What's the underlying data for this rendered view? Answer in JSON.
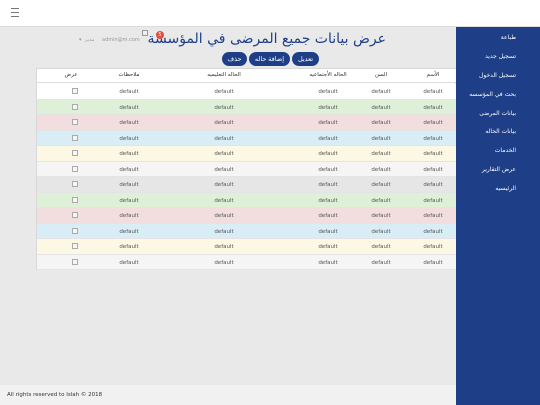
{
  "topbar": {
    "menu_icon": "hamburger-icon"
  },
  "header": {
    "title": "عرض بيانات جميع المرضى في المؤسسة",
    "notification_count": "5",
    "user_email": "admin@m.com",
    "user_role": "مدير"
  },
  "actions": {
    "edit_label": "تعديل",
    "add_label": "إضافة حاله",
    "delete_label": "حذف"
  },
  "sidebar": {
    "items": [
      {
        "label": "طباعة"
      },
      {
        "label": "تسجيل جديد"
      },
      {
        "label": "تسجيل الدخول"
      },
      {
        "label": "بحث في المؤسسه"
      },
      {
        "label": "بيانات المرضى"
      },
      {
        "label": "بيانات الحاله"
      },
      {
        "label": "الخدمات"
      },
      {
        "label": "عرض التقارير"
      },
      {
        "label": "الرئيسيه"
      }
    ]
  },
  "table": {
    "columns": [
      "الأسم",
      "السن",
      "الحاله الأجتماعيه",
      "الحاله التعليميه",
      "ملاحظات",
      "عرض"
    ],
    "rows": [
      {
        "bg": "#ffffff",
        "cells": [
          "default",
          "default",
          "default",
          "default",
          "default"
        ]
      },
      {
        "bg": "#dff0d8",
        "cells": [
          "default",
          "default",
          "default",
          "default",
          "default"
        ]
      },
      {
        "bg": "#f2dede",
        "cells": [
          "default",
          "default",
          "default",
          "default",
          "default"
        ]
      },
      {
        "bg": "#d9edf7",
        "cells": [
          "default",
          "default",
          "default",
          "default",
          "default"
        ]
      },
      {
        "bg": "#fcf8e3",
        "cells": [
          "default",
          "default",
          "default",
          "default",
          "default"
        ]
      },
      {
        "bg": "#f5f5f5",
        "cells": [
          "default",
          "default",
          "default",
          "default",
          "default"
        ]
      },
      {
        "bg": "#e6e6e6",
        "cells": [
          "default",
          "default",
          "default",
          "default",
          "default"
        ]
      },
      {
        "bg": "#dff0d8",
        "cells": [
          "default",
          "default",
          "default",
          "default",
          "default"
        ]
      },
      {
        "bg": "#f2dede",
        "cells": [
          "default",
          "default",
          "default",
          "default",
          "default"
        ]
      },
      {
        "bg": "#d9edf7",
        "cells": [
          "default",
          "default",
          "default",
          "default",
          "default"
        ]
      },
      {
        "bg": "#fcf8e3",
        "cells": [
          "default",
          "default",
          "default",
          "default",
          "default"
        ]
      },
      {
        "bg": "#f5f5f5",
        "cells": [
          "default",
          "default",
          "default",
          "default",
          "default"
        ]
      }
    ]
  },
  "footer": {
    "text": "All rights reserved to Islah © 2018"
  },
  "colors": {
    "brand": "#1e3f87",
    "badge": "#e74c3c"
  }
}
